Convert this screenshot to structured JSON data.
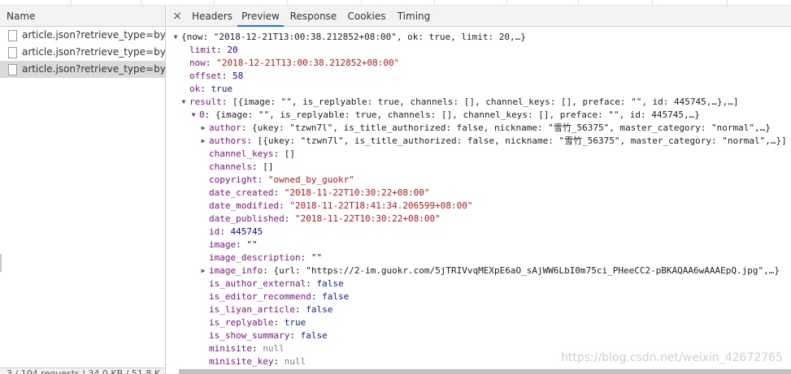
{
  "left_panel": {
    "header": "Name",
    "requests": [
      {
        "name": "article.json?retrieve_type=by_s...",
        "selected": false
      },
      {
        "name": "article.json?retrieve_type=by_s...",
        "selected": false
      },
      {
        "name": "article.json?retrieve_type=by_s...",
        "selected": true
      }
    ],
    "status": "3 / 104 requests | 34.0 KB / 51.8 K"
  },
  "tabs": {
    "close_glyph": "×",
    "items": [
      "Headers",
      "Preview",
      "Response",
      "Cookies",
      "Timing"
    ],
    "active": "Preview"
  },
  "preview": {
    "root_summary": "{now: \"2018-12-21T13:00:38.212852+08:00\", ok: true, limit: 20,…}",
    "limit": {
      "key": "limit",
      "value": "20"
    },
    "now": {
      "key": "now",
      "value": "\"2018-12-21T13:00:38.212852+08:00\""
    },
    "offset": {
      "key": "offset",
      "value": "58"
    },
    "ok": {
      "key": "ok",
      "value": "true"
    },
    "result": {
      "key": "result",
      "summary": "[{image: \"\", is_replyable: true, channels: [], channel_keys: [], preface: \"\", id: 445745,…},…]"
    },
    "item0": {
      "key": "0",
      "summary": "{image: \"\", is_replyable: true, channels: [], channel_keys: [], preface: \"\", id: 445745,…}"
    },
    "author": {
      "key": "author",
      "summary": "{ukey: \"tzwn7l\", is_title_authorized: false, nickname: \"雪竹_56375\", master_category: \"normal\",…}"
    },
    "authors": {
      "key": "authors",
      "summary": "[{ukey: \"tzwn7l\", is_title_authorized: false, nickname: \"雪竹_56375\", master_category: \"normal\",…}]"
    },
    "channel_keys": {
      "key": "channel_keys",
      "value": "[]"
    },
    "channels": {
      "key": "channels",
      "value": "[]"
    },
    "copyright": {
      "key": "copyright",
      "value": "\"owned_by_guokr\""
    },
    "date_created": {
      "key": "date_created",
      "value": "\"2018-11-22T10:30:22+08:00\""
    },
    "date_modified": {
      "key": "date_modified",
      "value": "\"2018-11-22T18:41:34.206599+08:00\""
    },
    "date_published": {
      "key": "date_published",
      "value": "\"2018-11-22T10:30:22+08:00\""
    },
    "id": {
      "key": "id",
      "value": "445745"
    },
    "image": {
      "key": "image",
      "value": "\"\""
    },
    "image_description": {
      "key": "image_description",
      "value": "\"\""
    },
    "image_info": {
      "key": "image_info",
      "summary": "{url: \"https://2-im.guokr.com/5jTRIVvqMEXpE6aO_sAjWW6LbI0m75ci_PHeeCC2-pBKAQAA6wAAAEpQ.jpg\",…}"
    },
    "is_author_external": {
      "key": "is_author_external",
      "value": "false"
    },
    "is_editor_recommend": {
      "key": "is_editor_recommend",
      "value": "false"
    },
    "is_liyan_article": {
      "key": "is_liyan_article",
      "value": "false"
    },
    "is_replyable": {
      "key": "is_replyable",
      "value": "true"
    },
    "is_show_summary": {
      "key": "is_show_summary",
      "value": "false"
    },
    "minisite": {
      "key": "minisite",
      "value": "null"
    },
    "minisite_key": {
      "key": "minisite_key",
      "value": "null"
    }
  },
  "watermark": "https://blog.csdn.net/weixin_42672765",
  "colors": {
    "key": "#881391",
    "string": "#c41a16",
    "number": "#1c00cf",
    "boolean": "#0d22aa",
    "null": "#808080",
    "active_tab_underline": "#1a73e8",
    "selected_row": "#dadada"
  }
}
